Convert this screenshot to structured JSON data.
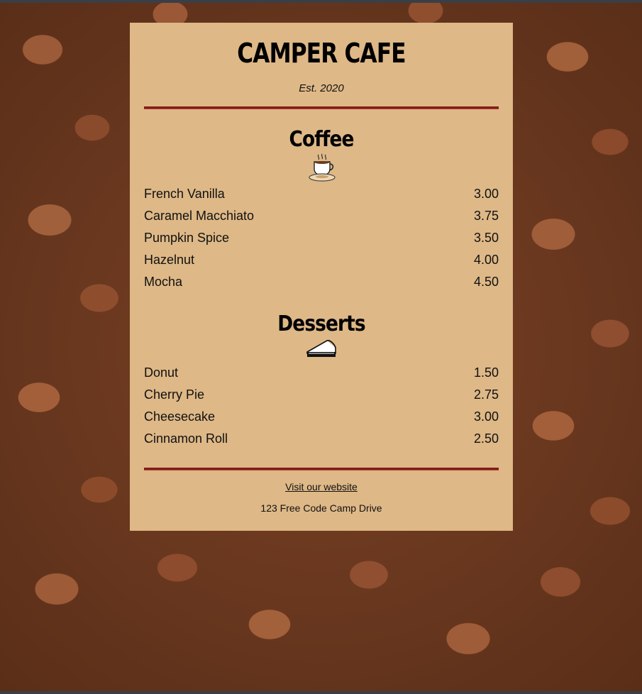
{
  "cafe": {
    "name": "CAMPER CAFE",
    "established": "Est. 2020"
  },
  "coffee": {
    "title": "Coffee",
    "icon": "coffee-cup-icon",
    "items": [
      {
        "flavor": "French Vanilla",
        "price": "3.00"
      },
      {
        "flavor": "Caramel Macchiato",
        "price": "3.75"
      },
      {
        "flavor": "Pumpkin Spice",
        "price": "3.50"
      },
      {
        "flavor": "Hazelnut",
        "price": "4.00"
      },
      {
        "flavor": "Mocha",
        "price": "4.50"
      }
    ]
  },
  "desserts": {
    "title": "Desserts",
    "icon": "pie-slice-icon",
    "items": [
      {
        "flavor": "Donut",
        "price": "1.50"
      },
      {
        "flavor": "Cherry Pie",
        "price": "2.75"
      },
      {
        "flavor": "Cheesecake",
        "price": "3.00"
      },
      {
        "flavor": "Cinnamon Roll",
        "price": "2.50"
      }
    ]
  },
  "footer": {
    "link_text": "Visit our website",
    "address": "123 Free Code Camp Drive"
  },
  "colors": {
    "menu_bg": "#deb887",
    "divider": "#7e1f1a",
    "text": "#111111"
  },
  "background": {
    "image": "coffee-beans-photo"
  }
}
